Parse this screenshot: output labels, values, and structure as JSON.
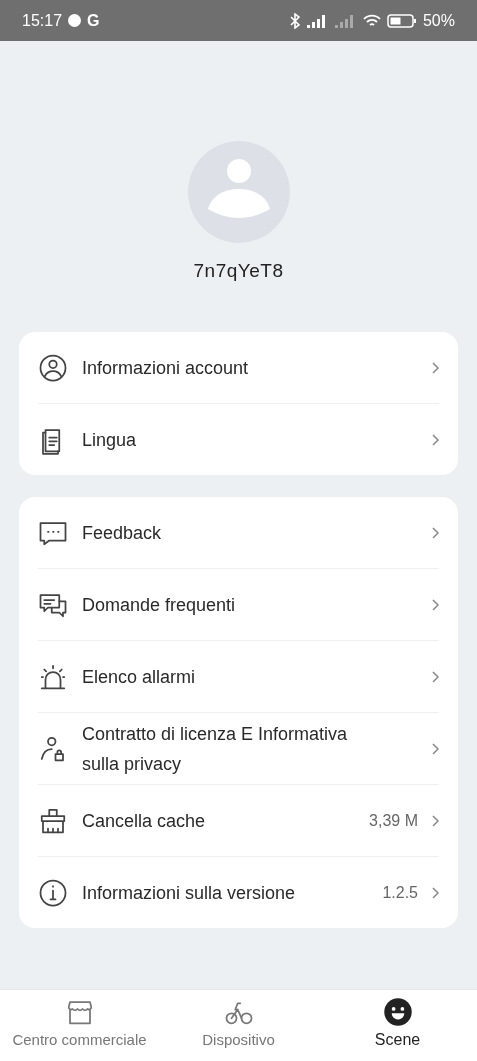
{
  "status_bar": {
    "time": "15:17",
    "carrier": "G",
    "battery": "50%"
  },
  "profile": {
    "username": "7n7qYeT8"
  },
  "menu_groups": [
    {
      "items": [
        {
          "kind": "user",
          "label": "Informazioni account"
        },
        {
          "kind": "document",
          "label": "Lingua"
        }
      ]
    },
    {
      "items": [
        {
          "kind": "chat",
          "label": "Feedback"
        },
        {
          "kind": "faq",
          "label": "Domande frequenti"
        },
        {
          "kind": "alarm",
          "label": "Elenco allarmi"
        },
        {
          "kind": "privacy",
          "label": "Contratto di licenza E Informativa sulla privacy"
        },
        {
          "kind": "cache",
          "label": "Cancella cache",
          "value": "3,39 M"
        },
        {
          "kind": "info",
          "label": "Informazioni sulla versione",
          "value": "1.2.5"
        }
      ]
    }
  ],
  "bottom_nav": [
    {
      "kind": "shop",
      "label": "Centro commerciale",
      "selected": false
    },
    {
      "kind": "bike",
      "label": "Dispositivo",
      "selected": false
    },
    {
      "kind": "smile",
      "label": "Scene",
      "selected": true
    }
  ]
}
